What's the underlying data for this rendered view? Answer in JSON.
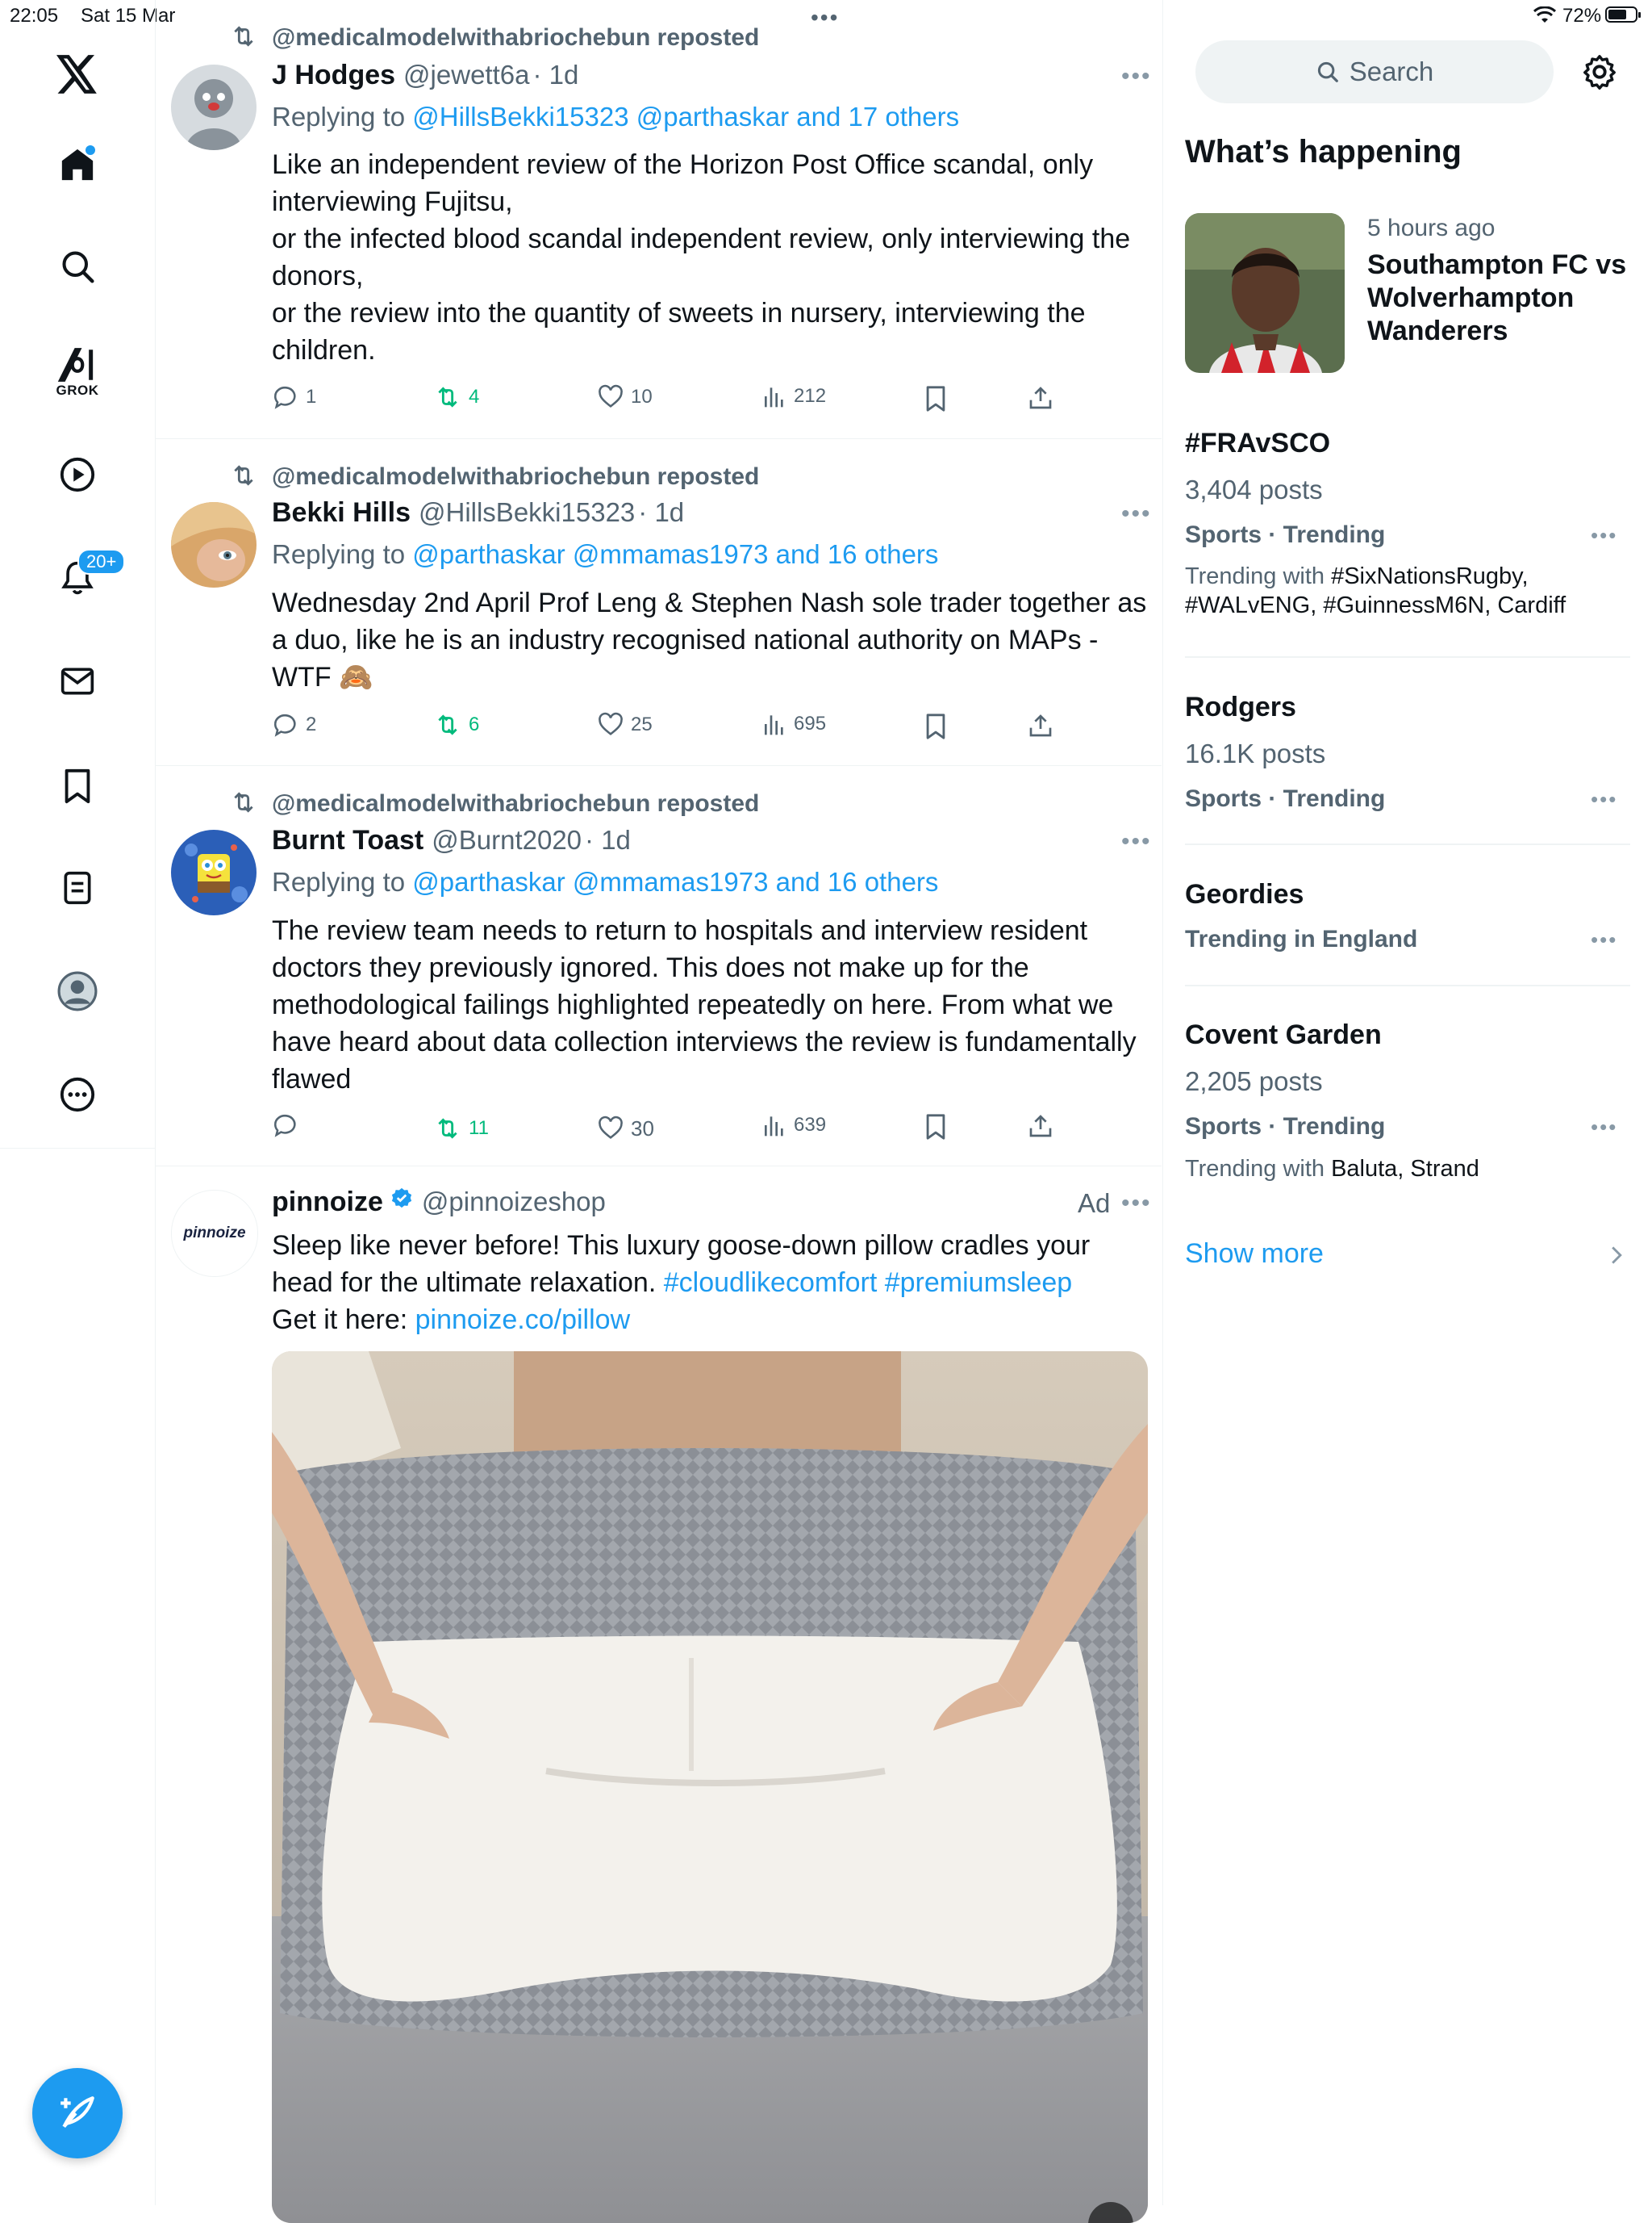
{
  "status": {
    "time": "22:05",
    "date": "Sat 15 Mar",
    "battery_pct": "72%",
    "battery_level": 0.72,
    "center_dots": "•••"
  },
  "nav": {
    "items": [
      {
        "id": "x-logo"
      },
      {
        "id": "home"
      },
      {
        "id": "explore"
      },
      {
        "id": "grok",
        "label": "GROK"
      },
      {
        "id": "video"
      },
      {
        "id": "notifications",
        "badge": "20+"
      },
      {
        "id": "messages"
      },
      {
        "id": "bookmarks"
      },
      {
        "id": "lists"
      },
      {
        "id": "profile"
      },
      {
        "id": "more"
      }
    ],
    "accent": "#1d9bf0"
  },
  "feed": {
    "tweets": [
      {
        "repost": "@medicalmodelwithabriochebun reposted",
        "name": "J Hodges",
        "handle": "@jewett6a",
        "time": "· 1d",
        "reply_prefix": "Replying to ",
        "reply_to": "@HillsBekki15323 @parthaskar and 17 others",
        "text": "Like an independent review of the Horizon Post Office scandal, only\ninterviewing Fujitsu,\nor the infected blood scandal independent review, only interviewing the\ndonors,\nor the review into the quantity of sweets in nursery, interviewing the\nchildren.",
        "replies": "1",
        "reposts": "4",
        "likes": "10",
        "views": "212",
        "more": "•••"
      },
      {
        "repost": "@medicalmodelwithabriochebun reposted",
        "name": "Bekki Hills",
        "handle": "@HillsBekki15323",
        "time": "· 1d",
        "reply_prefix": "Replying to ",
        "reply_to": "@parthaskar @mmamas1973 and 16 others",
        "text": "Wednesday 2nd April Prof Leng & Stephen Nash sole trader together as\na duo, like he is an industry recognised national authority on MAPs -\nWTF 🙈",
        "replies": "2",
        "reposts": "6",
        "likes": "25",
        "views": "695",
        "more": "•••"
      },
      {
        "repost": "@medicalmodelwithabriochebun reposted",
        "name": "Burnt Toast",
        "handle": "@Burnt2020",
        "time": "· 1d",
        "reply_prefix": "Replying to ",
        "reply_to": "@parthaskar @mmamas1973 and 16 others",
        "text": "The review team needs to return to hospitals and interview resident\ndoctors they previously ignored. This does not make up for the\nmethodological failings highlighted repeatedly on here. From what we\nhave heard about data collection interviews the review is fundamentally\nflawed",
        "replies": "",
        "reposts": "11",
        "likes": "30",
        "views": "639",
        "more": "•••"
      }
    ],
    "ad": {
      "name": "pinnoize",
      "handle": "@pinnoizeshop",
      "ad_label": "Ad",
      "more": "•••",
      "logo_text": "pinnoize",
      "text_line1": "Sleep like never before! This luxury goose-down pillow cradles your",
      "text_line2_plain": "head for the ultimate relaxation. ",
      "hashtags": "#cloudlikecomfort #premiumsleep",
      "get_it": "Get it here: ",
      "link": "pinnoize.co/pillow"
    }
  },
  "sidebar": {
    "search_placeholder": "Search",
    "heading": "What’s happening",
    "top_story": {
      "time": "5 hours ago",
      "title_line1": "Southampton FC vs",
      "title_line2": "Wolverhampton",
      "title_line3": "Wanderers"
    },
    "trends": [
      {
        "title": "#FRAvSCO",
        "posts": "3,404 posts",
        "category": "Sports · Trending",
        "with_label": "Trending with ",
        "with": "#SixNationsRugby, #WALvENG, #GuinnessM6N, Cardiff"
      },
      {
        "title": "Rodgers",
        "posts": "16.1K posts",
        "category": "Sports · Trending"
      },
      {
        "title": "Geordies",
        "category": "Trending in England"
      },
      {
        "title": "Covent Garden",
        "posts": "2,205 posts",
        "category": "Sports · Trending",
        "with_label": "Trending with ",
        "with": "Baluta, Strand"
      }
    ],
    "show_more": "Show more",
    "more": "•••"
  }
}
